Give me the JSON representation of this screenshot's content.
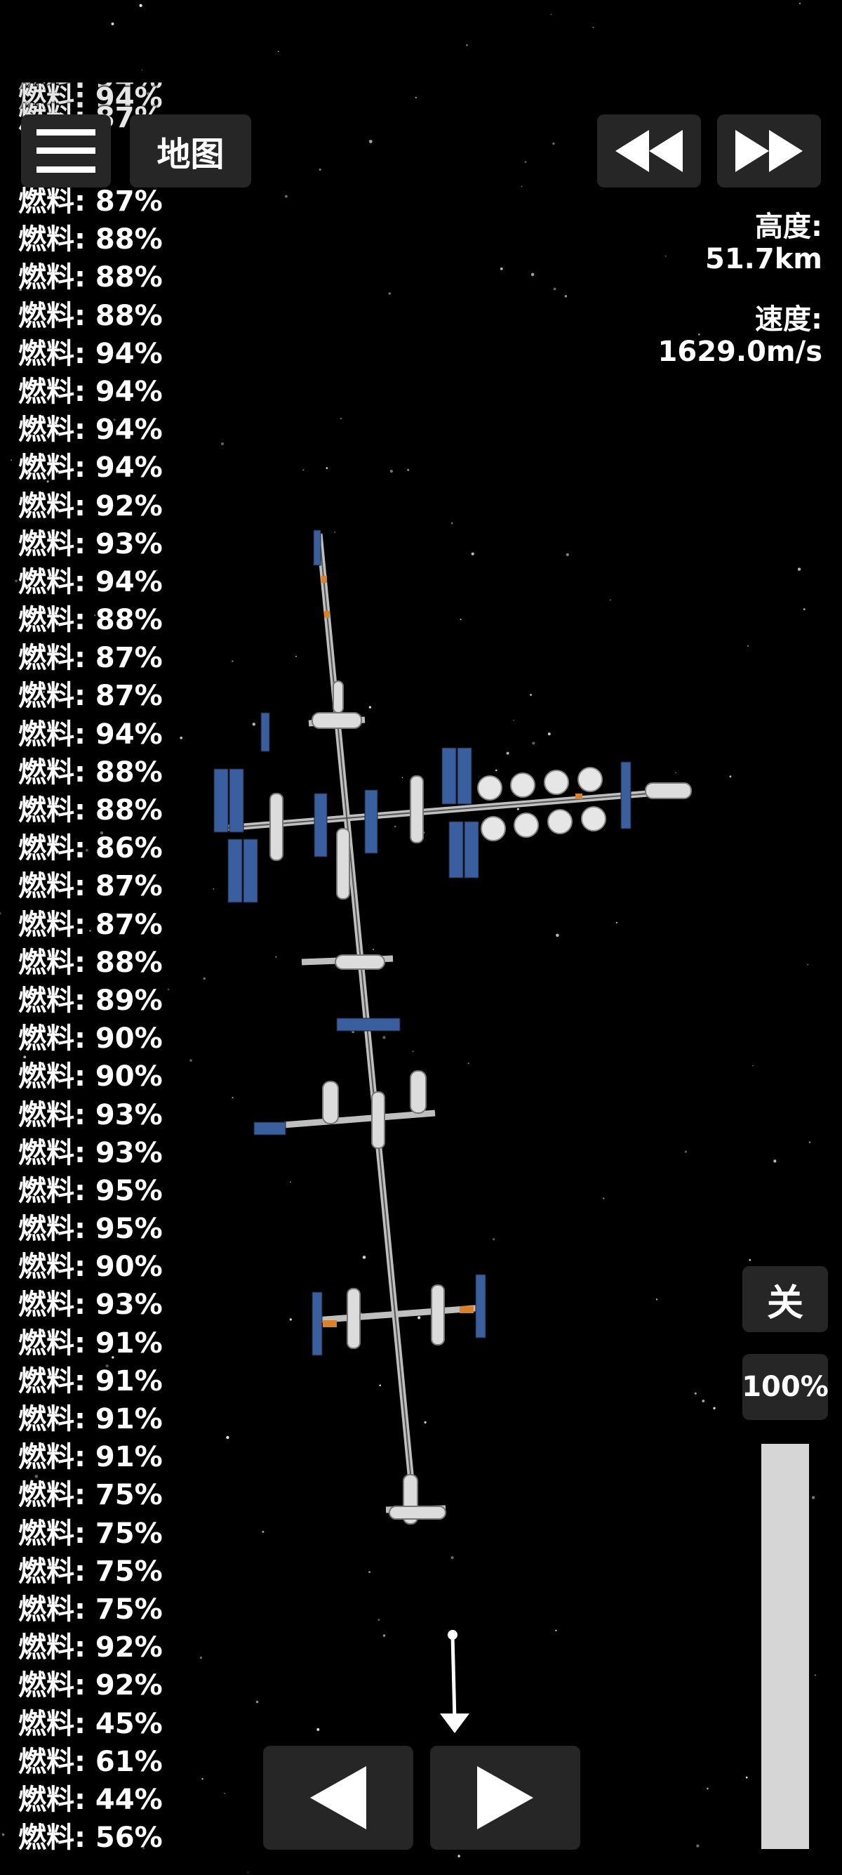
{
  "fuel_list": {
    "partial_top": [
      "燃料: 94%",
      "燃料: 94%",
      "燃料: 87%"
    ],
    "entries": [
      "燃料: 87%",
      "燃料: 88%",
      "燃料: 88%",
      "燃料: 88%",
      "燃料: 94%",
      "燃料: 94%",
      "燃料: 94%",
      "燃料: 94%",
      "燃料: 92%",
      "燃料: 93%",
      "燃料: 94%",
      "燃料: 88%",
      "燃料: 87%",
      "燃料: 87%",
      "燃料: 94%",
      "燃料: 88%",
      "燃料: 88%",
      "燃料: 86%",
      "燃料: 87%",
      "燃料: 87%",
      "燃料: 88%",
      "燃料: 89%",
      "燃料: 90%",
      "燃料: 90%",
      "燃料: 93%",
      "燃料: 93%",
      "燃料: 95%",
      "燃料: 95%",
      "燃料: 90%",
      "燃料: 93%",
      "燃料: 91%",
      "燃料: 91%",
      "燃料: 91%",
      "燃料: 91%",
      "燃料: 75%",
      "燃料: 75%",
      "燃料: 75%",
      "燃料: 75%",
      "燃料: 92%",
      "燃料: 92%",
      "燃料: 45%",
      "燃料: 61%",
      "燃料: 44%",
      "燃料: 56%"
    ]
  },
  "top_left": {
    "menu_icon": "hamburger-menu-icon",
    "map_label": "地图"
  },
  "top_right": {
    "rewind_icon": "rewind-icon",
    "fast_forward_icon": "fast-forward-icon"
  },
  "telemetry": {
    "altitude_label": "高度:",
    "altitude_value": "51.7km",
    "speed_label": "速度:",
    "speed_value": "1629.0m/s"
  },
  "controls": {
    "toggle_label": "关",
    "throttle_label": "100%",
    "throttle_level": 1.0,
    "rotate_left_icon": "rotate-left-icon",
    "rotate_right_icon": "rotate-right-icon",
    "direction_icon": "velocity-direction-arrow-icon"
  },
  "colors": {
    "background": "#000000",
    "button_bg": "#262626",
    "text": "#ffffff",
    "throttle_bar": "#d6d6d6",
    "solar_panel": "#3a5f9e",
    "module": "#d9d9d9",
    "accent_orange": "#d9822b"
  }
}
